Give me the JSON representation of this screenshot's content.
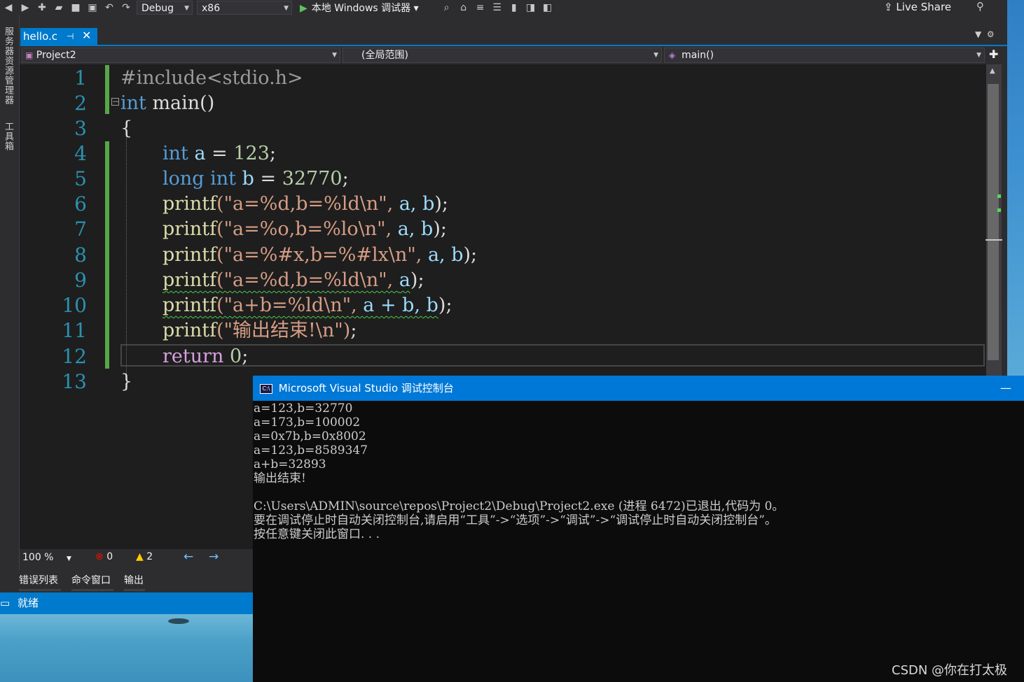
{
  "toolbar": {
    "config": "Debug",
    "platform": "x86",
    "run_label": "本地 Windows 调试器",
    "live_share": "Live Share"
  },
  "left_tabs": [
    "服务器资源管理器",
    "工具箱"
  ],
  "doc_tab": {
    "title": "hello.c"
  },
  "nav": {
    "project": "Project2",
    "scope": "(全局范围)",
    "member": "main()"
  },
  "editor": {
    "lines": [
      {
        "n": "1"
      },
      {
        "n": "2"
      },
      {
        "n": "3"
      },
      {
        "n": "4"
      },
      {
        "n": "5"
      },
      {
        "n": "6"
      },
      {
        "n": "7"
      },
      {
        "n": "8"
      },
      {
        "n": "9"
      },
      {
        "n": "10"
      },
      {
        "n": "11"
      },
      {
        "n": "12"
      },
      {
        "n": "13"
      }
    ],
    "code": {
      "l1": "#include<stdio.h>",
      "l2_kw": "int",
      "l2_rest": " main()",
      "l3": "{",
      "l4_kw": "int",
      "l4_var": " a ",
      "l4_op": "= ",
      "l4_num": "123",
      "l4_end": ";",
      "l5_kw": "long int",
      "l5_var": " b ",
      "l5_op": "= ",
      "l5_num": "32770",
      "l5_end": ";",
      "l6_fn": "printf",
      "l6_str": "(\"a=%d,b=%ld\\n\", ",
      "l6_args": "a, b",
      "l6_end": ");",
      "l7_fn": "printf",
      "l7_str": "(\"a=%o,b=%lo\\n\", ",
      "l7_args": "a, b",
      "l7_end": ");",
      "l8_fn": "printf",
      "l8_str": "(\"a=%#x,b=%#lx\\n\", ",
      "l8_args": "a, b",
      "l8_end": ");",
      "l9_fn": "printf",
      "l9_str": "(\"a=%d,b=%ld\\n\", ",
      "l9_args": "a",
      "l9_end": ");",
      "l10_fn": "printf",
      "l10_str": "(\"a+b=%ld\\n\", ",
      "l10_args": "a + b, b",
      "l10_end": ");",
      "l11_fn": "printf",
      "l11_str": "(\"输出结束!\\n\")",
      "l11_end": ";",
      "l12_kw": "return",
      "l12_num": " 0",
      "l12_end": ";",
      "l13": "}"
    }
  },
  "edit_status": {
    "zoom": "100 %",
    "errors": "0",
    "warnings": "2"
  },
  "panel_tabs": [
    "错误列表",
    "命令窗口",
    "输出"
  ],
  "statusbar": {
    "text": "就绪"
  },
  "console": {
    "title": "Microsoft Visual Studio 调试控制台",
    "output": "a=123,b=32770\na=173,b=100002\na=0x7b,b=0x8002\na=123,b=8589347\na+b=32893\n输出结束!\n\nC:\\Users\\ADMIN\\source\\repos\\Project2\\Debug\\Project2.exe (进程 6472)已退出,代码为 0。\n要在调试停止时自动关闭控制台,请启用“工具”->“选项”->“调试”->“调试停止时自动关闭控制台”。\n按任意键关闭此窗口. . ."
  },
  "watermark": "CSDN @你在打太极"
}
